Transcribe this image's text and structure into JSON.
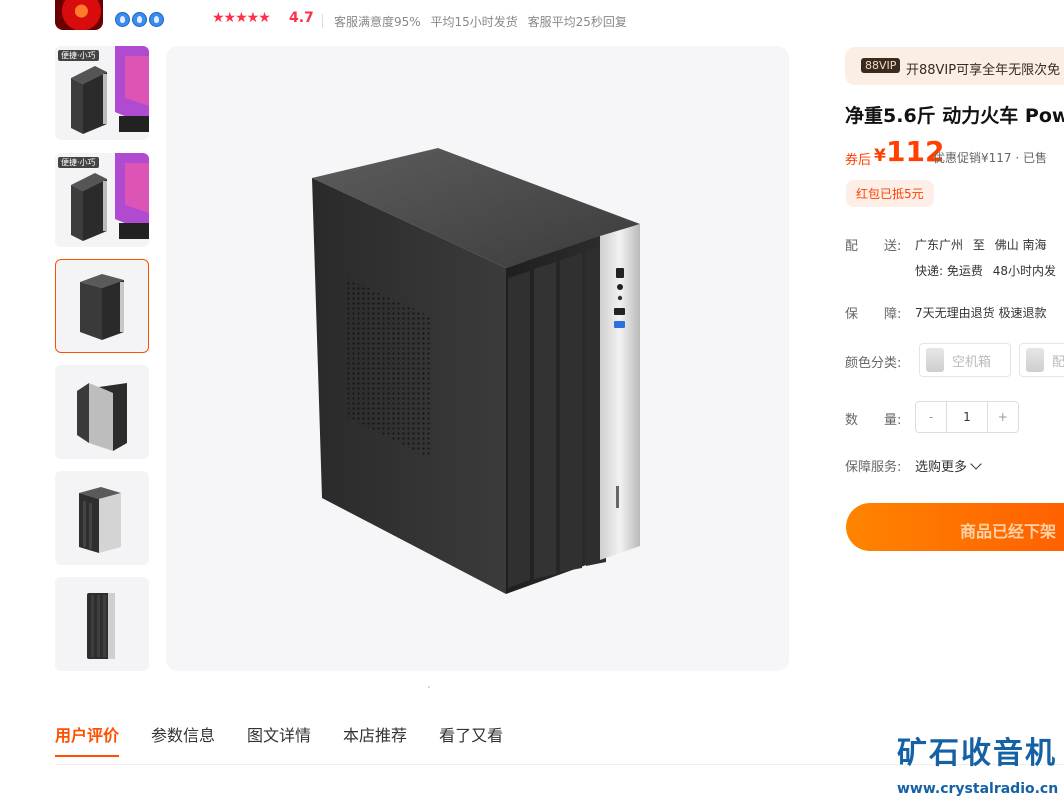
{
  "header": {
    "rating_stars": "★★★★★",
    "rating": "4.7",
    "metrics": [
      "客服满意度95%",
      "平均15小时发货",
      "客服平均25秒回复"
    ]
  },
  "gallery": {
    "thumb_tag": "便捷·小巧",
    "thumbnail_count": 6,
    "active_thumbnail": 3
  },
  "vip": {
    "tag": "88VIP",
    "text": "开88VIP可享全年无限次免"
  },
  "product": {
    "title": "净重5.6斤 动力火车 Pow",
    "price_prefix": "券后",
    "currency": "¥",
    "price": "112",
    "price_note": "优惠促销¥117 · 已售",
    "coupon": "红包已抵5元"
  },
  "delivery": {
    "label": "配　　送:",
    "from": "广东广州",
    "to_word": "至",
    "to": "佛山 南海",
    "shipping": "快递: 免运费",
    "eta": "48小时内发"
  },
  "guarantee": {
    "label": "保　　障:",
    "text": "7天无理由退货 极速退款"
  },
  "color": {
    "label": "颜色分类:",
    "options": [
      "空机箱",
      "配"
    ]
  },
  "quantity": {
    "label": "数　　量:",
    "minus": "-",
    "value": "1",
    "plus": "+"
  },
  "service": {
    "label": "保障服务:",
    "more": "选购更多"
  },
  "buy_button": {
    "label": "商品已经下架"
  },
  "tabs": [
    {
      "label": "用户评价",
      "active": true
    },
    {
      "label": "参数信息"
    },
    {
      "label": "图文详情"
    },
    {
      "label": "本店推荐"
    },
    {
      "label": "看了又看"
    }
  ],
  "watermark": {
    "title": "矿石收音机",
    "url": "www.crystalradio.cn"
  },
  "colors": {
    "accent": "#ff5000",
    "price": "#ff4000",
    "watermark": "#1461a6"
  }
}
